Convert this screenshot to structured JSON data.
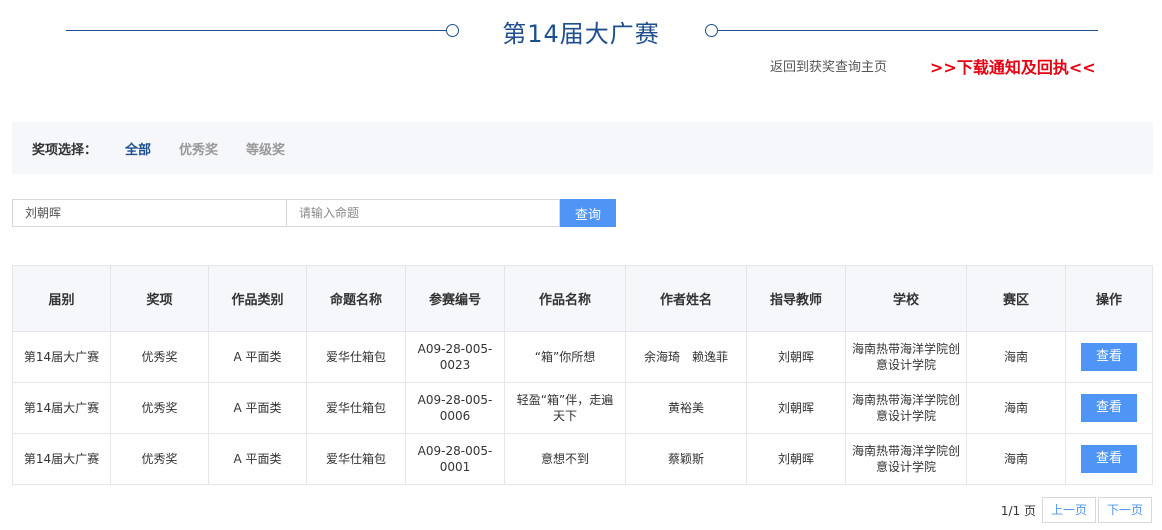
{
  "header": {
    "title": "第14届大广赛",
    "back_link": "返回到获奖查询主页",
    "download_link": ">>下载通知及回执<<"
  },
  "filter": {
    "label": "奖项选择：",
    "options": [
      "全部",
      "优秀奖",
      "等级奖"
    ],
    "selected": "全部"
  },
  "search": {
    "name_value": "",
    "name_placeholder": "刘朝晖",
    "topic_placeholder": "请输入命题",
    "button": "查询"
  },
  "table": {
    "headers": [
      "届别",
      "奖项",
      "作品类别",
      "命题名称",
      "参赛编号",
      "作品名称",
      "作者姓名",
      "指导教师",
      "学校",
      "赛区",
      "操作"
    ],
    "rows": [
      [
        "第14届大广赛",
        "优秀奖",
        "A 平面类",
        "爱华仕箱包",
        "A09-28-005-0023",
        "“箱”你所想",
        "余海琦　赖逸菲",
        "刘朝晖",
        "海南热带海洋学院创意设计学院",
        "海南",
        "查看"
      ],
      [
        "第14届大广赛",
        "优秀奖",
        "A 平面类",
        "爱华仕箱包",
        "A09-28-005-0006",
        "轻盈“箱”伴，走遍天下",
        "黄裕美",
        "刘朝晖",
        "海南热带海洋学院创意设计学院",
        "海南",
        "查看"
      ],
      [
        "第14届大广赛",
        "优秀奖",
        "A 平面类",
        "爱华仕箱包",
        "A09-28-005-0001",
        "意想不到",
        "蔡颖斯",
        "刘朝晖",
        "海南热带海洋学院创意设计学院",
        "海南",
        "查看"
      ]
    ]
  },
  "pagination": {
    "info": "1/1 页",
    "prev": "上一页",
    "next": "下一页"
  },
  "colors": {
    "brand_blue": "#1f4e8c",
    "button_blue": "#4f95f5",
    "alert_red": "#e60012"
  }
}
